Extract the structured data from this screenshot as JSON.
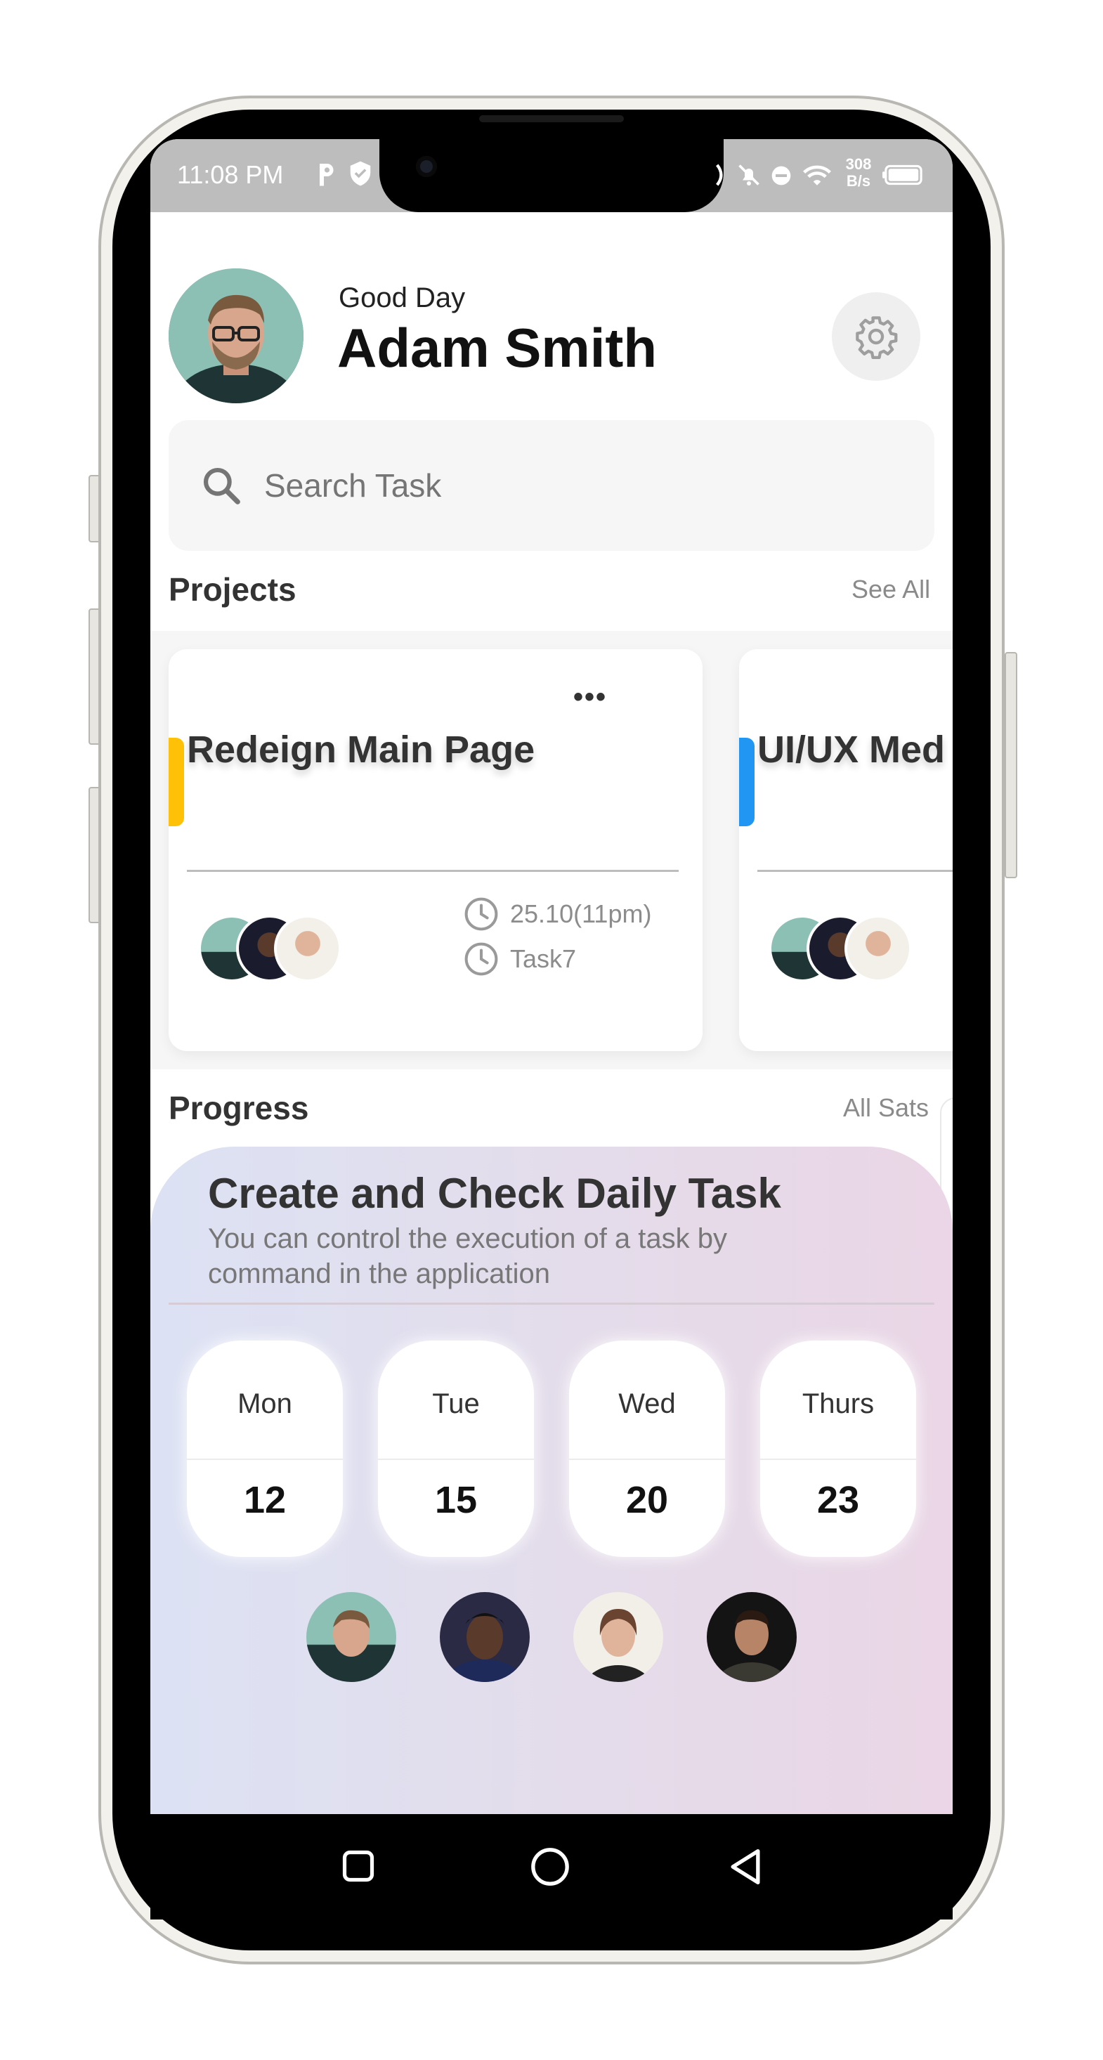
{
  "status_bar": {
    "time": "11:08 PM",
    "net_speed_value": "308",
    "net_speed_unit": "B/s"
  },
  "header": {
    "greeting": "Good Day",
    "user_name": "Adam Smith"
  },
  "search": {
    "placeholder": "Search Task"
  },
  "projects": {
    "title": "Projects",
    "see_all": "See All",
    "cards": [
      {
        "title": "Redeign Main Page",
        "menu": "•••",
        "due": "25.10(11pm)",
        "task": "Task7",
        "accent": "#ffc107"
      },
      {
        "title": "UI/UX Med",
        "accent": "#2196f3"
      }
    ]
  },
  "progress": {
    "title": "Progress",
    "link": "All Sats",
    "card_title": "Create and Check Daily Task",
    "card_desc": "You can control the execution of a task by command in the application",
    "days": [
      {
        "name": "Mon",
        "num": "12"
      },
      {
        "name": "Tue",
        "num": "15"
      },
      {
        "name": "Wed",
        "num": "20"
      },
      {
        "name": "Thurs",
        "num": "23"
      }
    ]
  },
  "colors": {
    "accent_yellow": "#ffc107",
    "accent_blue": "#2196f3"
  },
  "icons": {
    "settings": "gear-icon",
    "search": "search-icon",
    "clock": "clock-icon",
    "nav_recent": "square-icon",
    "nav_home": "circle-icon",
    "nav_back": "triangle-back-icon"
  }
}
